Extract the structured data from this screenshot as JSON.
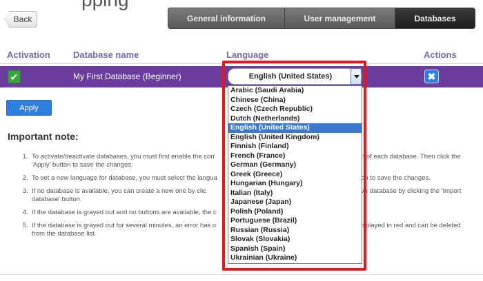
{
  "header": {
    "title_fragment": "pping",
    "back_label": "Back",
    "tabs": [
      {
        "label": "General information"
      },
      {
        "label": "User management"
      },
      {
        "label": "Databases"
      }
    ]
  },
  "table": {
    "columns": {
      "activation": "Activation",
      "name": "Database name",
      "language": "Language",
      "actions": "Actions"
    },
    "row": {
      "name": "My First Database (Beginner)"
    }
  },
  "language_select": {
    "selected": "English (United States)",
    "options": [
      "Arabic (Saudi Arabia)",
      "Chinese (China)",
      "Czech (Czech Republic)",
      "Dutch (Netherlands)",
      "English (United States)",
      "English (United Kingdom)",
      "Finnish (Finland)",
      "French (France)",
      "German (Germany)",
      "Greek (Greece)",
      "Hungarian (Hungary)",
      "Italian (Italy)",
      "Japanese (Japan)",
      "Polish (Poland)",
      "Portuguese (Brazil)",
      "Russian (Russia)",
      "Slovak (Slovakia)",
      "Spanish (Spain)",
      "Ukrainian (Ukraine)"
    ]
  },
  "apply_label": "Apply",
  "note": {
    "title": "Important note:",
    "items": [
      {
        "num": "1.",
        "left": "To activate/deactivate databases, you must first enable the corr",
        "right": "n of each database. Then click the",
        "cont": "'Apply' button to save the changes."
      },
      {
        "num": "2.",
        "left": "To set a new language for database, you must select the langua",
        "right": "on to save the changes.",
        "cont": ""
      },
      {
        "num": "3.",
        "left": "If no database is available, you can create a new one by clic",
        "right": "vn database by clicking the 'Import",
        "cont": "database' button."
      },
      {
        "num": "4.",
        "left": "If the database is grayed out and no buttons are available, the c",
        "right": "",
        "cont": ""
      },
      {
        "num": "5.",
        "left": "If the database is grayed out for several minutes, an error has o",
        "right": "isplayed in red and can be deleted",
        "cont": "from the database list."
      }
    ]
  },
  "colors": {
    "row_purple": "#6c3d9e",
    "accent_blue": "#2f7fe0",
    "highlight_red": "#e0191f",
    "header_text": "#7a68a6"
  }
}
